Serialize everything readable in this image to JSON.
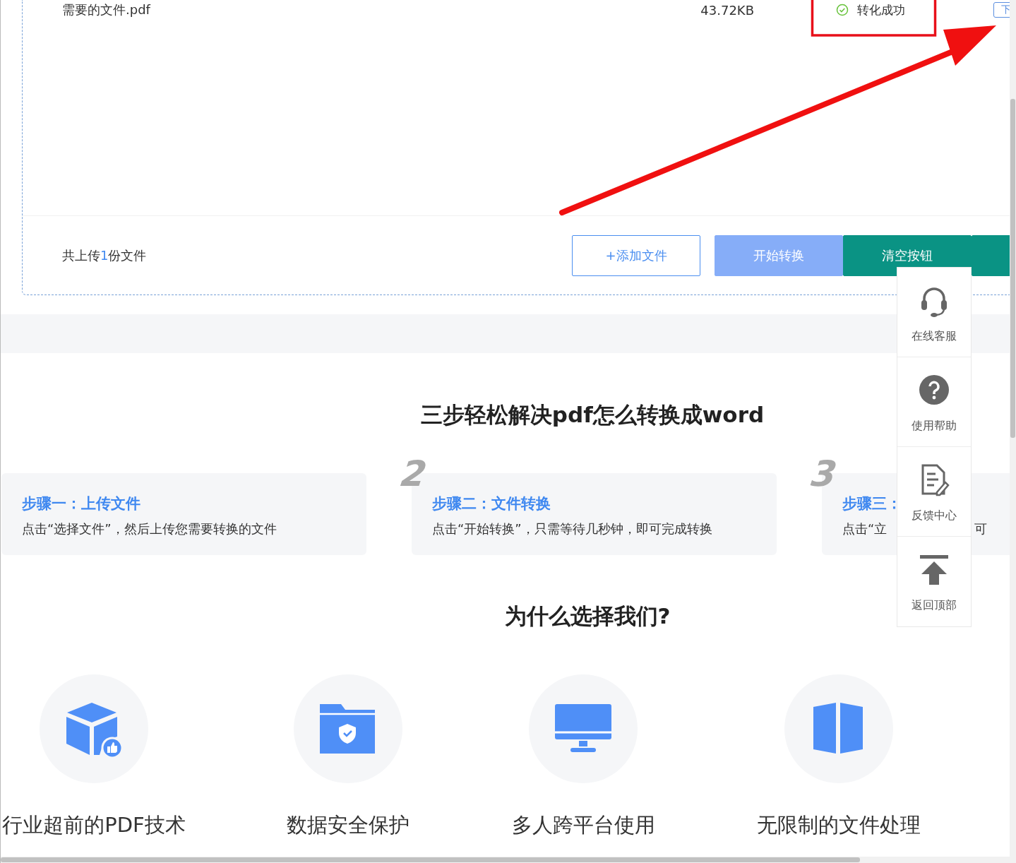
{
  "upload_panel": {
    "files": [
      {
        "name": "需要的文件.pdf",
        "size": "43.72KB",
        "status": "转化成功",
        "action": "下"
      }
    ],
    "summary": {
      "before": "共上传",
      "count": "1",
      "after": "份文件"
    },
    "buttons": [
      {
        "label": "+添加文件",
        "kind": "outline"
      },
      {
        "label": "开始转换",
        "kind": "primary"
      },
      {
        "label": "清空按钮",
        "kind": "teal"
      },
      {
        "kind": "teal"
      }
    ]
  },
  "steps_section": {
    "title": "三步轻松解决pdf怎么转换成word",
    "steps": [
      {
        "title": "步骤一：上传文件",
        "description_parts": [
          "点击“选择文件”，然后上传您需要转换的文件"
        ]
      },
      {
        "number": "2",
        "title": "步骤二：文件转换",
        "description_parts": [
          "点击“开始转换”，只需等待几秒钟，即可完成转换"
        ]
      },
      {
        "number": "3",
        "title": "步骤三：",
        "description_parts": [
          "点击“立",
          "可"
        ]
      }
    ]
  },
  "why_section": {
    "title": "为什么选择我们?",
    "features": [
      {
        "label": "行业超前的PDF技术"
      },
      {
        "label": "数据安全保护"
      },
      {
        "label": "多人跨平台使用"
      },
      {
        "label": "无限制的文件处理"
      }
    ]
  },
  "float_widget": {
    "items": [
      {
        "label": "在线客服"
      },
      {
        "label": "使用帮助"
      },
      {
        "label": "反馈中心"
      },
      {
        "label": "返回顶部"
      }
    ]
  }
}
